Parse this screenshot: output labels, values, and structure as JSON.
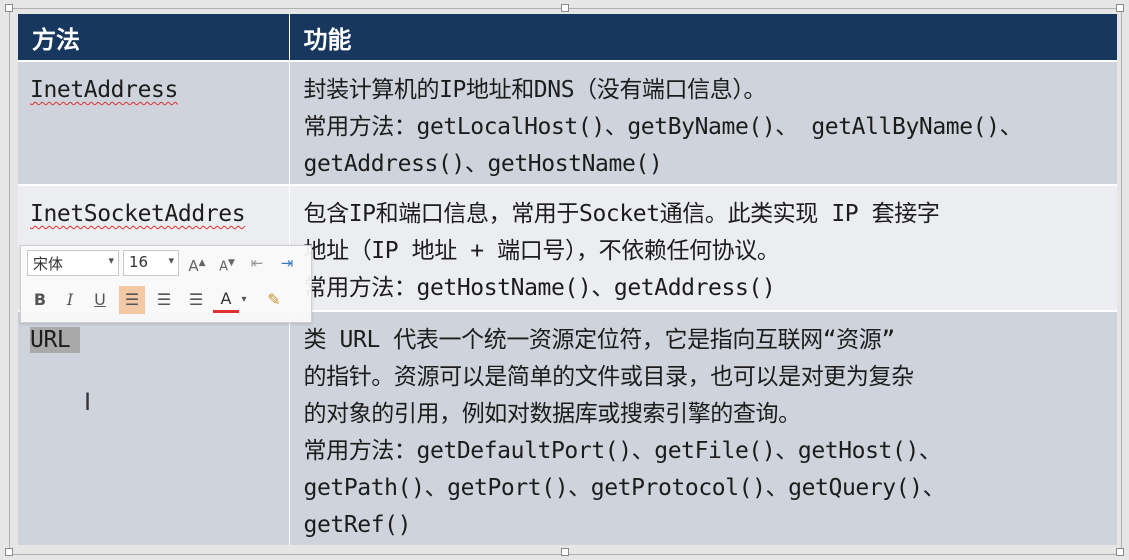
{
  "table": {
    "headers": [
      "方法",
      "功能"
    ],
    "rows": [
      {
        "method": "InetAddress",
        "lines": [
          "封装计算机的IP地址和DNS（没有端口信息）。",
          "常用方法：getLocalHost()、getByName()、 getAllByName()、",
          "getAddress()、getHostName()"
        ]
      },
      {
        "method": "InetSocketAddres",
        "lines": [
          "包含IP和端口信息，常用于Socket通信。此类实现 IP 套接字",
          "地址（IP 地址 + 端口号），不依赖任何协议。",
          "常用方法：getHostName()、getAddress()"
        ]
      },
      {
        "method": "URL",
        "lines": [
          "类 URL 代表一个统一资源定位符，它是指向互联网“资源”",
          "的指针。资源可以是简单的文件或目录，也可以是对更为复杂",
          "的对象的引用，例如对数据库或搜索引擎的查询。",
          "常用方法：getDefaultPort()、getFile()、getHost()、",
          "getPath()、getPort()、getProtocol()、getQuery()、",
          "getRef()"
        ]
      }
    ]
  },
  "mini_toolbar": {
    "font_name": "宋体",
    "font_size": "16",
    "buttons_row1": [
      "A",
      "A"
    ],
    "buttons_row2": [
      "B",
      "I",
      "U",
      "A"
    ],
    "icons": [
      "grow-font-icon",
      "shrink-font-icon",
      "decrease-indent-icon",
      "increase-indent-icon",
      "bold-icon",
      "italic-icon",
      "underline-icon",
      "align-left-icon",
      "align-center-icon",
      "align-right-icon",
      "font-color-icon",
      "format-painter-icon"
    ]
  },
  "colors": {
    "header_bg": "#17375e",
    "row_dark": "#cfd4dc",
    "row_light": "#ebedf0",
    "highlight": "#f3c9a5",
    "spell_underline": "#e03030"
  }
}
